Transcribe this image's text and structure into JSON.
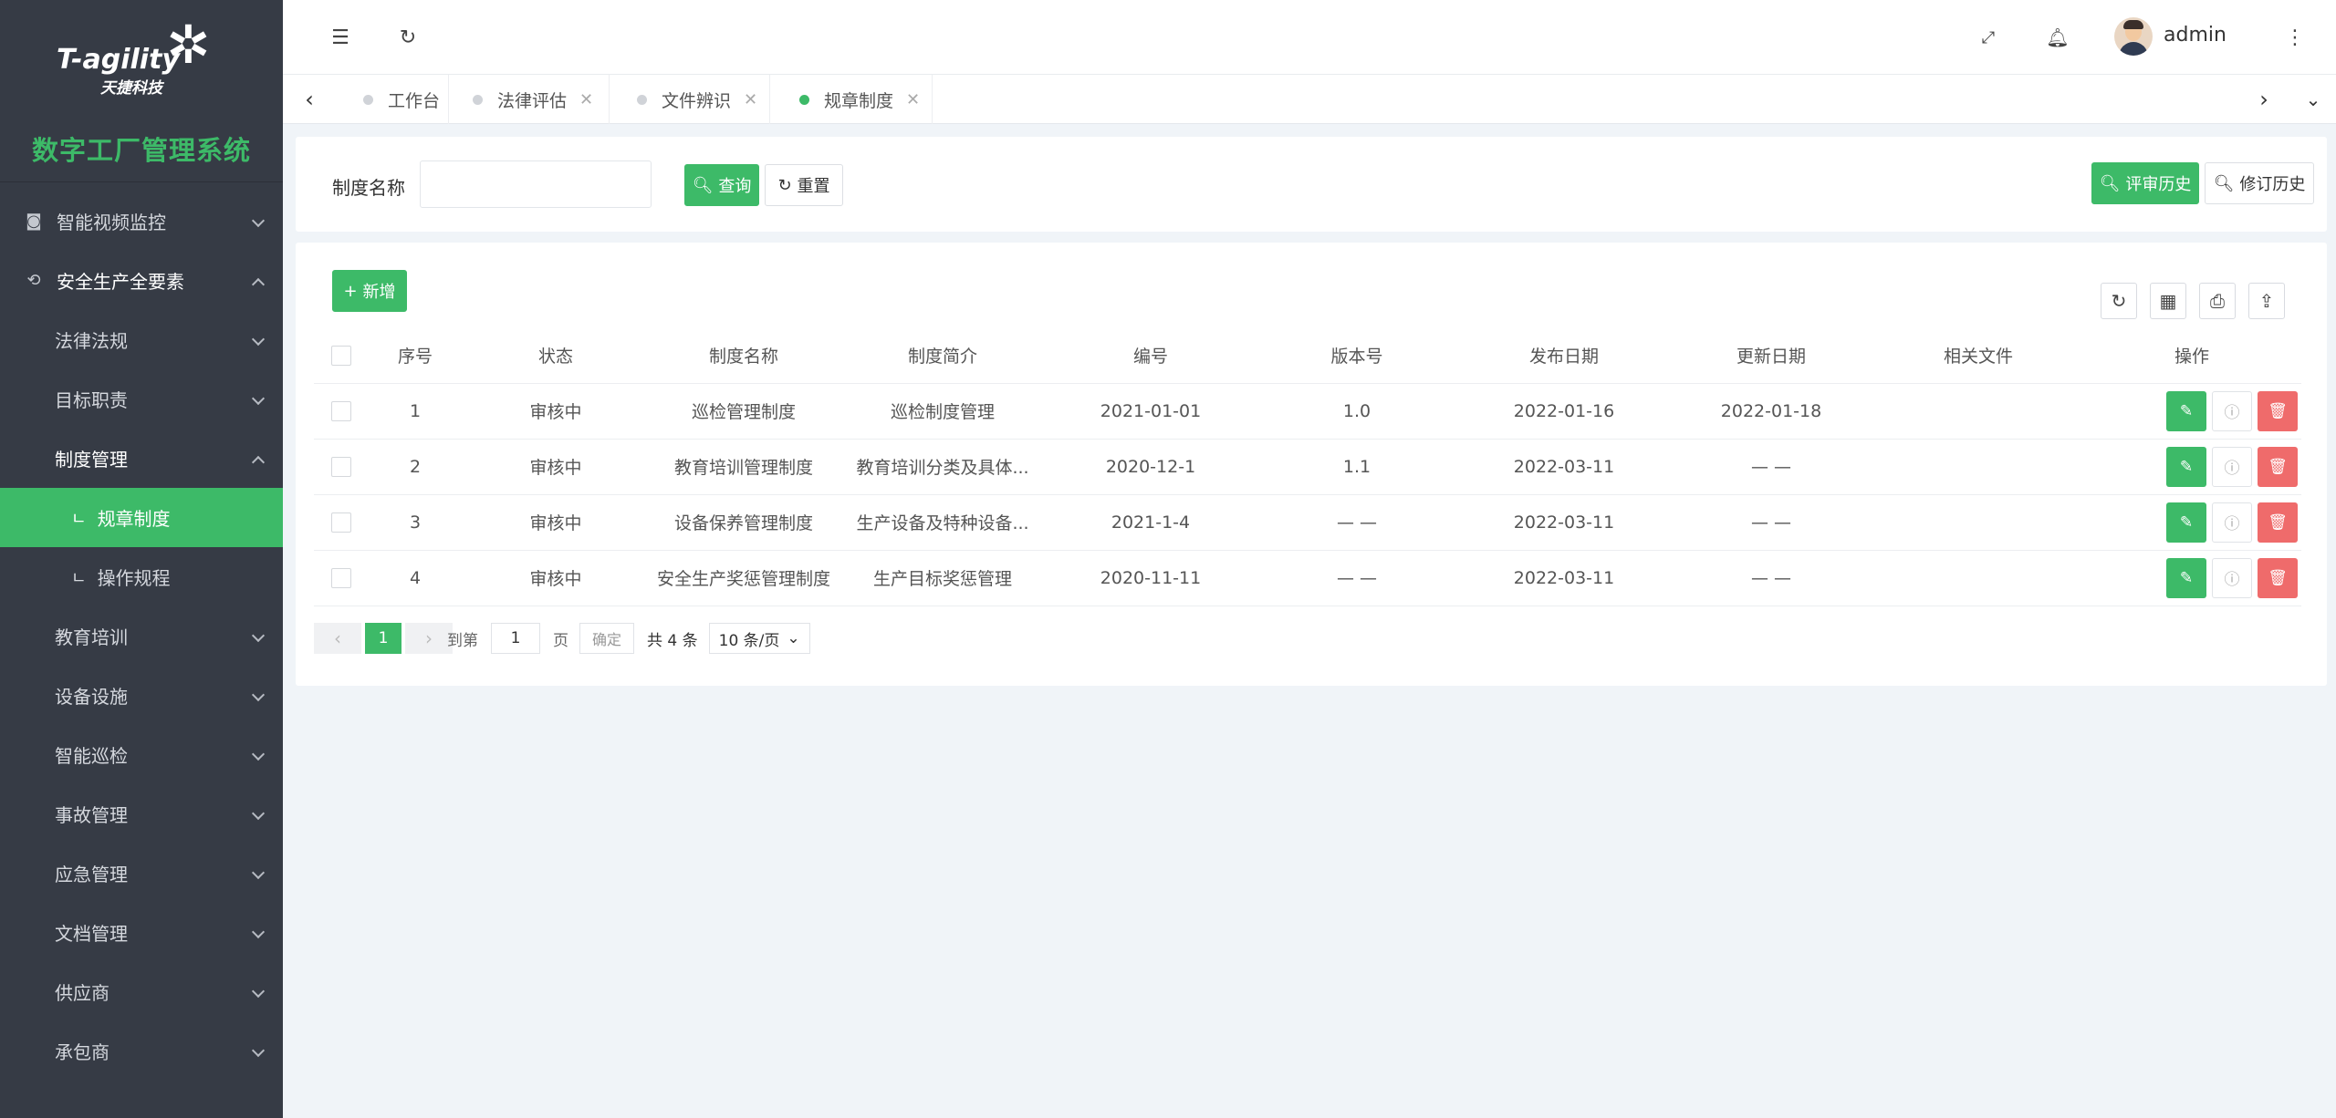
{
  "brand": {
    "logo_text": "T-agility",
    "logo_sub": "天捷科技",
    "system_title": "数字工厂管理系统"
  },
  "sidebar": {
    "items": [
      {
        "label": "智能视频监控"
      },
      {
        "label": "安全生产全要素"
      },
      {
        "label": "法律法规"
      },
      {
        "label": "目标职责"
      },
      {
        "label": "制度管理"
      },
      {
        "label": "规章制度"
      },
      {
        "label": "操作规程"
      },
      {
        "label": "教育培训"
      },
      {
        "label": "设备设施"
      },
      {
        "label": "智能巡检"
      },
      {
        "label": "事故管理"
      },
      {
        "label": "应急管理"
      },
      {
        "label": "文档管理"
      },
      {
        "label": "供应商"
      },
      {
        "label": "承包商"
      }
    ]
  },
  "header": {
    "username": "admin"
  },
  "tabs": [
    {
      "label": "工作台"
    },
    {
      "label": "法律评估"
    },
    {
      "label": "文件辨识"
    },
    {
      "label": "规章制度"
    }
  ],
  "search": {
    "label": "制度名称",
    "value": "",
    "query_btn": "查询",
    "reset_btn": "重置",
    "review_history_btn": "评审历史",
    "revision_history_btn": "修订历史"
  },
  "table": {
    "add_btn": "新增",
    "columns": [
      "序号",
      "状态",
      "制度名称",
      "制度简介",
      "编号",
      "版本号",
      "发布日期",
      "更新日期",
      "相关文件",
      "操作"
    ],
    "rows": [
      {
        "no": "1",
        "status": "审核中",
        "name": "巡检管理制度",
        "intro": "巡检制度管理",
        "code": "2021-01-01",
        "version": "1.0",
        "publish": "2022-01-16",
        "update": "2022-01-18",
        "files": ""
      },
      {
        "no": "2",
        "status": "审核中",
        "name": "教育培训管理制度",
        "intro": "教育培训分类及具体...",
        "code": "2020-12-1",
        "version": "1.1",
        "publish": "2022-03-11",
        "update": "— —",
        "files": ""
      },
      {
        "no": "3",
        "status": "审核中",
        "name": "设备保养管理制度",
        "intro": "生产设备及特种设备...",
        "code": "2021-1-4",
        "version": "— —",
        "publish": "2022-03-11",
        "update": "— —",
        "files": ""
      },
      {
        "no": "4",
        "status": "审核中",
        "name": "安全生产奖惩管理制度",
        "intro": "生产目标奖惩管理",
        "code": "2020-11-11",
        "version": "— —",
        "publish": "2022-03-11",
        "update": "— —",
        "files": ""
      }
    ]
  },
  "pager": {
    "current": "1",
    "goto_label": "到第",
    "goto_value": "1",
    "page_label": "页",
    "confirm": "确定",
    "total": "共 4 条",
    "page_size": "10 条/页"
  },
  "colors": {
    "accent": "#3dba68",
    "sidebar_bg": "#363b45",
    "danger": "#ef6b6b",
    "notify": "#f04d2a"
  }
}
